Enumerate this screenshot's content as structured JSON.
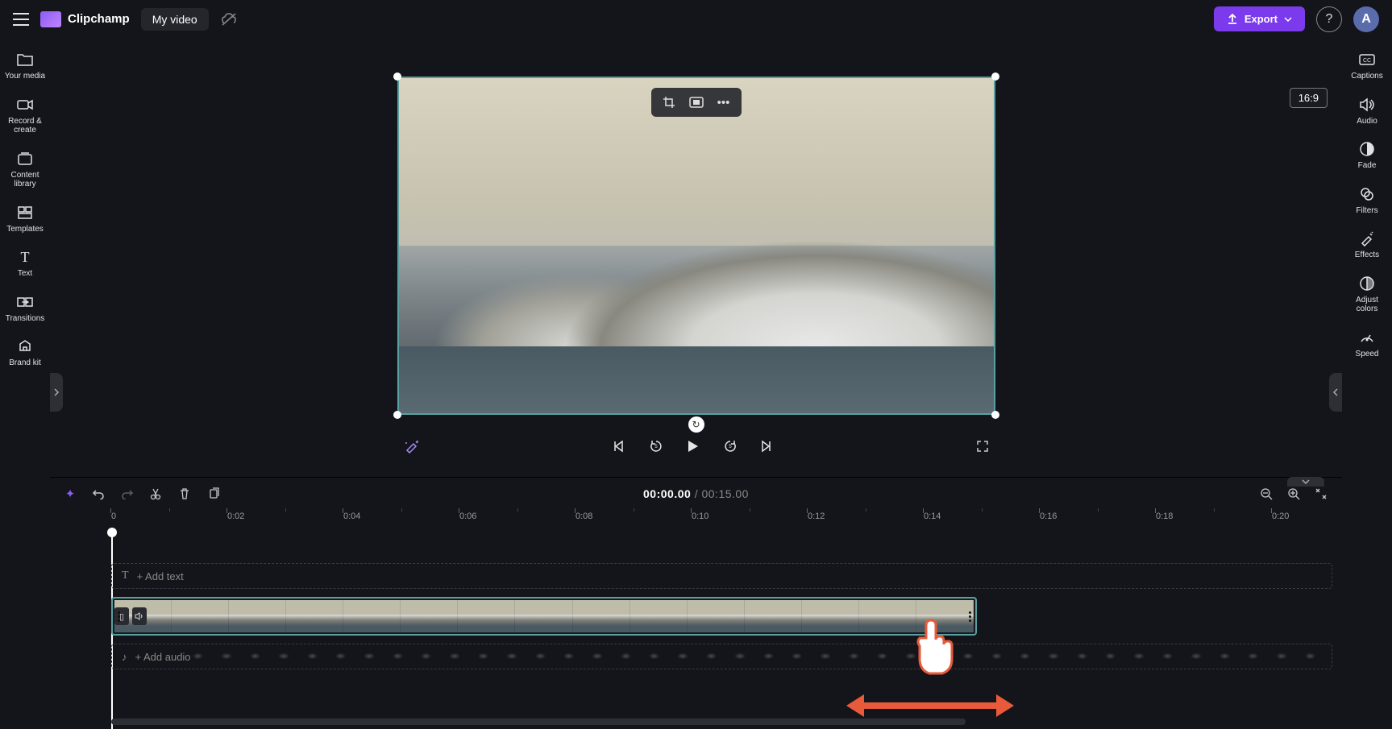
{
  "app": {
    "name": "Clipchamp",
    "document_title": "My video",
    "export_label": "Export",
    "aspect_ratio": "16:9",
    "avatar_initial": "A"
  },
  "left_rail": [
    {
      "key": "your-media",
      "label": "Your media"
    },
    {
      "key": "record-create",
      "label": "Record &\ncreate"
    },
    {
      "key": "content-library",
      "label": "Content\nlibrary"
    },
    {
      "key": "templates",
      "label": "Templates"
    },
    {
      "key": "text",
      "label": "Text"
    },
    {
      "key": "transitions",
      "label": "Transitions"
    },
    {
      "key": "brand-kit",
      "label": "Brand kit"
    }
  ],
  "right_rail": [
    {
      "key": "captions",
      "label": "Captions"
    },
    {
      "key": "audio",
      "label": "Audio"
    },
    {
      "key": "fade",
      "label": "Fade"
    },
    {
      "key": "filters",
      "label": "Filters"
    },
    {
      "key": "effects",
      "label": "Effects"
    },
    {
      "key": "adjust-colors",
      "label": "Adjust\ncolors"
    },
    {
      "key": "speed",
      "label": "Speed"
    }
  ],
  "timecode": {
    "current": "00:00.00",
    "separator": " / ",
    "total": "00:15.00"
  },
  "ruler_ticks": [
    "0",
    "0:02",
    "0:04",
    "0:06",
    "0:08",
    "0:10",
    "0:12",
    "0:14",
    "0:16",
    "0:18",
    "0:20"
  ],
  "tracks": {
    "text_placeholder": "+ Add text",
    "audio_placeholder": "+ Add audio"
  }
}
